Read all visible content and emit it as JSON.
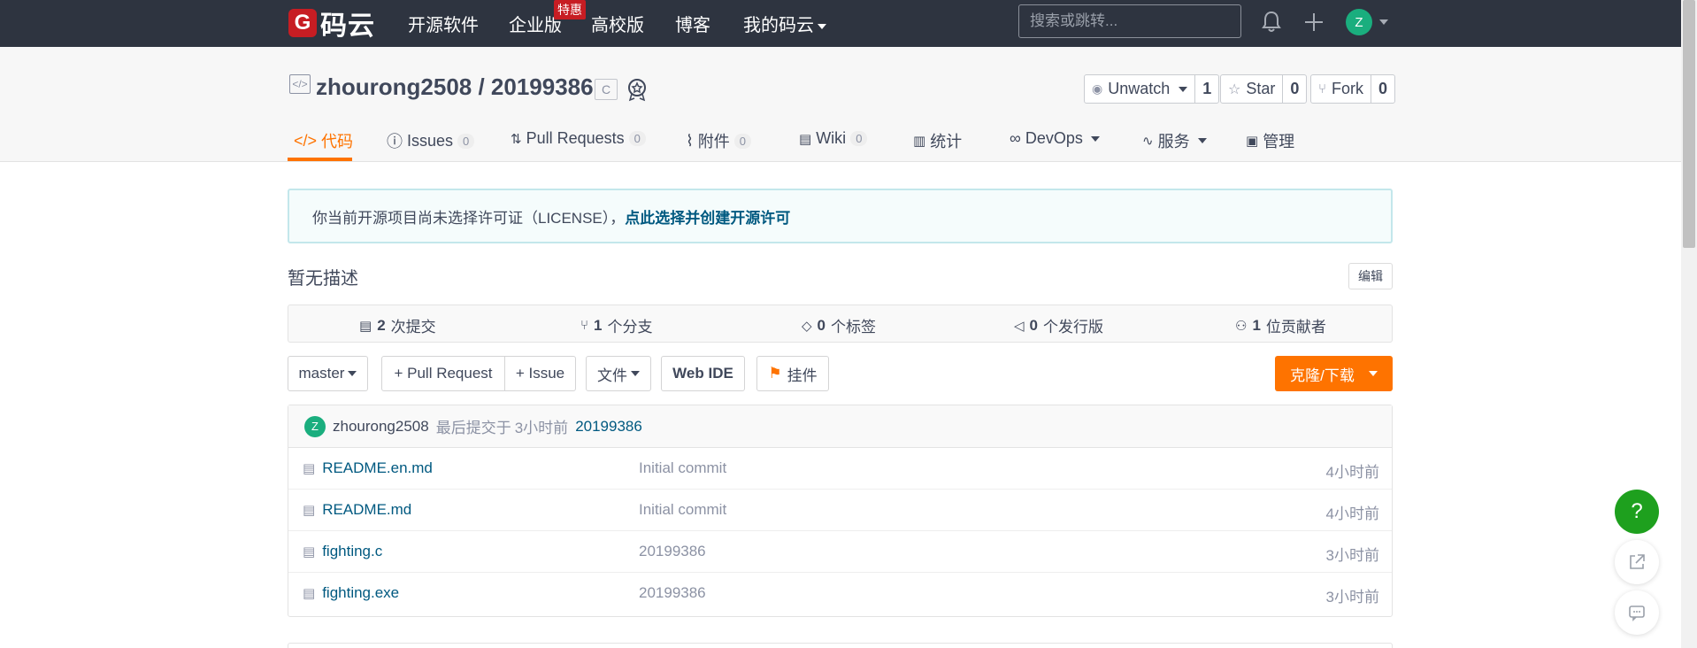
{
  "topnav": {
    "logo_mark": "G",
    "logo_text": "码云",
    "items": [
      "开源软件",
      "企业版",
      "高校版",
      "博客",
      "我的码云"
    ],
    "badge": "特惠",
    "search_placeholder": "搜索或跳转...",
    "avatar": "Z"
  },
  "repo": {
    "owner": "zhourong2508",
    "separator": " / ",
    "name": "20199386",
    "lang": "C",
    "watch_label": "Unwatch",
    "watch_count": "1",
    "star_label": "Star",
    "star_count": "0",
    "fork_label": "Fork",
    "fork_count": "0"
  },
  "tabs": [
    {
      "label": "代码"
    },
    {
      "label": "Issues",
      "count": "0"
    },
    {
      "label": "Pull Requests",
      "count": "0"
    },
    {
      "label": "附件",
      "count": "0"
    },
    {
      "label": "Wiki",
      "count": "0"
    },
    {
      "label": "统计"
    },
    {
      "label": "DevOps"
    },
    {
      "label": "服务"
    },
    {
      "label": "管理"
    }
  ],
  "notice": {
    "text": "你当前开源项目尚未选择许可证（LICENSE），",
    "link": "点此选择并创建开源许可"
  },
  "description": "暂无描述",
  "edit_label": "编辑",
  "stats": [
    {
      "num": "2",
      "label": "次提交"
    },
    {
      "num": "1",
      "label": "个分支"
    },
    {
      "num": "0",
      "label": "个标签"
    },
    {
      "num": "0",
      "label": "个发行版"
    },
    {
      "num": "1",
      "label": "位贡献者"
    }
  ],
  "toolbar": {
    "branch": "master",
    "pull_request": "+ Pull Request",
    "issue": "+ Issue",
    "files": "文件",
    "web_ide": "Web IDE",
    "widget": "挂件",
    "clone": "克隆/下载"
  },
  "last_commit": {
    "avatar": "Z",
    "author": "zhourong2508",
    "text": "最后提交于",
    "time": "3小时前",
    "message": "20199386"
  },
  "files": [
    {
      "name": "README.en.md",
      "message": "Initial commit",
      "time": "4小时前"
    },
    {
      "name": "README.md",
      "message": "Initial commit",
      "time": "4小时前"
    },
    {
      "name": "fighting.c",
      "message": "20199386",
      "time": "3小时前"
    },
    {
      "name": "fighting.exe",
      "message": "20199386",
      "time": "3小时前"
    }
  ],
  "help_label": "?",
  "colors": {
    "accent": "#fe7300",
    "nav_bg": "#2e3440",
    "link": "#005980",
    "help": "#1ea01e"
  }
}
